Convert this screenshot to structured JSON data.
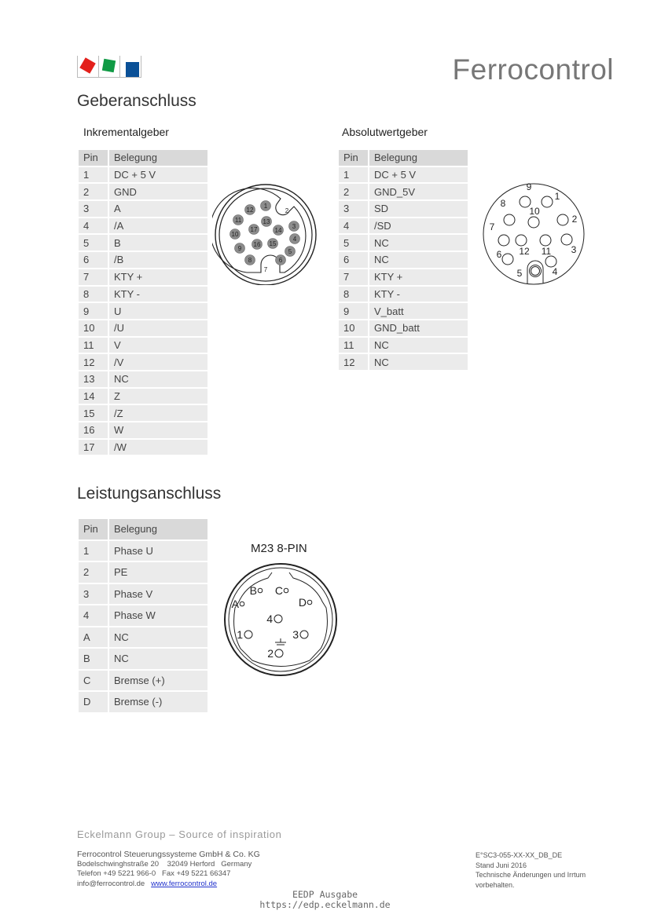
{
  "header": {
    "brand": "Ferrocontrol",
    "logo_colors": [
      "#e3201b",
      "#109a45",
      "#0a5097"
    ]
  },
  "geber": {
    "title": "Geberanschluss",
    "inkremental": {
      "title": "Inkrementalgeber",
      "columns": [
        "Pin",
        "Belegung"
      ],
      "rows": [
        [
          "1",
          "DC + 5 V"
        ],
        [
          "2",
          "GND"
        ],
        [
          "3",
          "A"
        ],
        [
          "4",
          "/A"
        ],
        [
          "5",
          "B"
        ],
        [
          "6",
          "/B"
        ],
        [
          "7",
          "KTY +"
        ],
        [
          "8",
          "KTY -"
        ],
        [
          "9",
          "U"
        ],
        [
          "10",
          "/U"
        ],
        [
          "11",
          "V"
        ],
        [
          "12",
          "/V"
        ],
        [
          "13",
          "NC"
        ],
        [
          "14",
          "Z"
        ],
        [
          "15",
          "/Z"
        ],
        [
          "16",
          "W"
        ],
        [
          "17",
          "/W"
        ]
      ],
      "connector_pins": [
        "1",
        "2",
        "3",
        "4",
        "5",
        "6",
        "7",
        "8",
        "9",
        "10",
        "11",
        "12",
        "13",
        "14",
        "15",
        "16",
        "17"
      ]
    },
    "absolut": {
      "title": "Absolutwertgeber",
      "columns": [
        "Pin",
        "Belegung"
      ],
      "rows": [
        [
          "1",
          "DC + 5 V"
        ],
        [
          "2",
          "GND_5V"
        ],
        [
          "3",
          "SD"
        ],
        [
          "4",
          "/SD"
        ],
        [
          "5",
          "NC"
        ],
        [
          "6",
          "NC"
        ],
        [
          "7",
          "KTY +"
        ],
        [
          "8",
          "KTY -"
        ],
        [
          "9",
          "V_batt"
        ],
        [
          "10",
          "GND_batt"
        ],
        [
          "11",
          "NC"
        ],
        [
          "12",
          "NC"
        ]
      ],
      "connector_pins": [
        "1",
        "2",
        "3",
        "4",
        "5",
        "6",
        "7",
        "8",
        "9",
        "10",
        "11",
        "12"
      ]
    }
  },
  "leistung": {
    "title": "Leistungsanschluss",
    "columns": [
      "Pin",
      "Belegung"
    ],
    "rows": [
      [
        "1",
        "Phase U"
      ],
      [
        "2",
        "PE"
      ],
      [
        "3",
        "Phase V"
      ],
      [
        "4",
        "Phase W"
      ],
      [
        "A",
        "NC"
      ],
      [
        "B",
        "NC"
      ],
      [
        "C",
        "Bremse (+)"
      ],
      [
        "D",
        "Bremse (-)"
      ]
    ],
    "connector_title": "M23 8-PIN",
    "connector_pins": [
      "A",
      "B",
      "C",
      "D",
      "1",
      "2",
      "3",
      "4"
    ]
  },
  "footer": {
    "tagline": "Eckelmann Group – Source of inspiration",
    "company": "Ferrocontrol Steuerungssysteme GmbH & Co. KG",
    "address": "Bodelschwinghstraße 20    32049 Herford   Germany",
    "phone": "Telefon +49 5221 966-0   Fax +49 5221 66347",
    "email": "info@ferrocontrol.de",
    "website": "www.ferrocontrol.de",
    "doc_id": "E°SC3-055-XX-XX_DB_DE",
    "date": "Stand Juni 2016",
    "disclaimer_1": "Technische Änderungen und Irrtum",
    "disclaimer_2": "vorbehalten."
  },
  "eedp": {
    "line1": "EEDP Ausgabe",
    "line2": "https://edp.eckelmann.de"
  }
}
